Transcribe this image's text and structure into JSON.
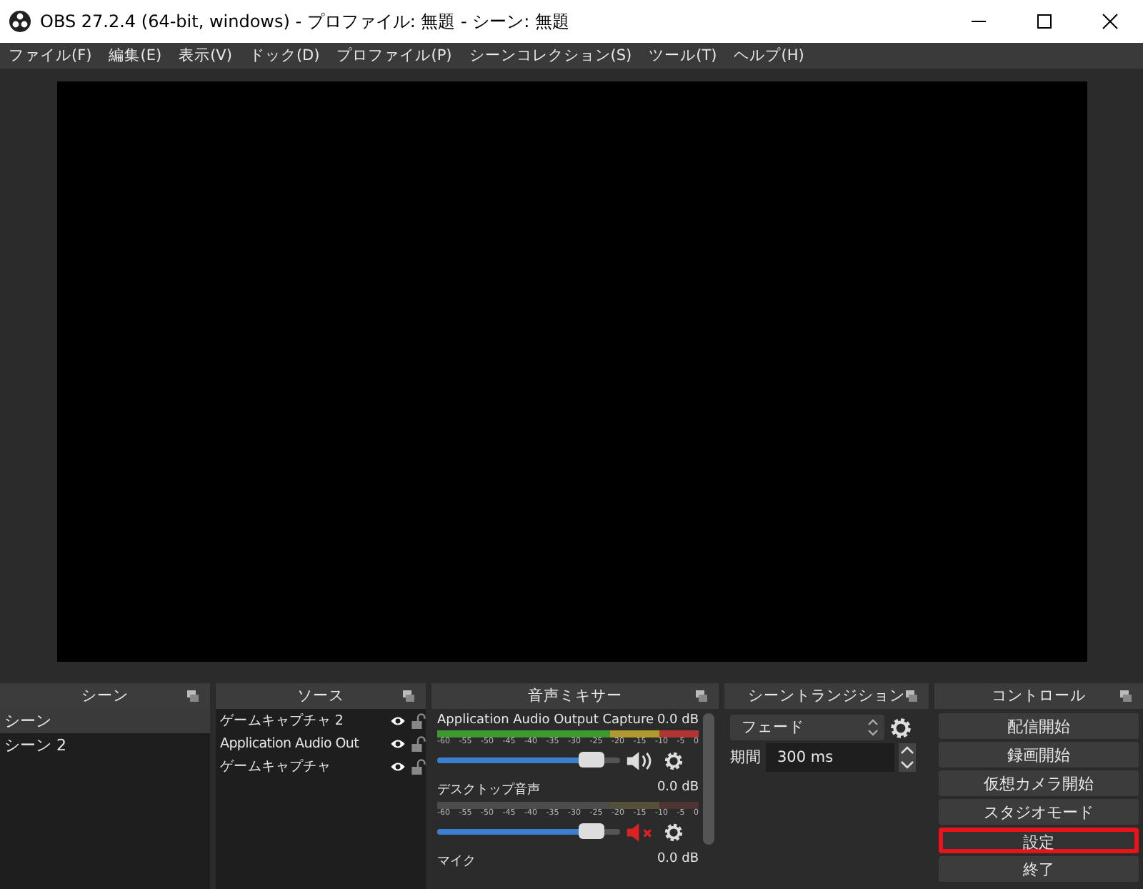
{
  "window": {
    "title": "OBS 27.2.4 (64-bit, windows) - プロファイル: 無題 - シーン: 無題"
  },
  "menu": [
    "ファイル(F)",
    "編集(E)",
    "表示(V)",
    "ドック(D)",
    "プロファイル(P)",
    "シーンコレクション(S)",
    "ツール(T)",
    "ヘルプ(H)"
  ],
  "scenes": {
    "title": "シーン",
    "items": [
      {
        "name": "シーン",
        "selected": true
      },
      {
        "name": "シーン 2",
        "selected": false
      }
    ]
  },
  "sources": {
    "title": "ソース",
    "items": [
      {
        "name": "ゲームキャプチャ 2",
        "visible": true,
        "locked": false
      },
      {
        "name": "Application Audio Out",
        "visible": true,
        "locked": false
      },
      {
        "name": "ゲームキャプチャ",
        "visible": true,
        "locked": false
      }
    ]
  },
  "mixer": {
    "title": "音声ミキサー",
    "channels": [
      {
        "name": "Application Audio Output Capture",
        "reading": "0.0 dB",
        "ticks": [
          "-60",
          "-55",
          "-50",
          "-45",
          "-40",
          "-35",
          "-30",
          "-25",
          "-20",
          "-15",
          "-10",
          "-5",
          "0"
        ],
        "level": 0.85,
        "muted": false
      },
      {
        "name": "デスクトップ音声",
        "reading": "0.0 dB",
        "ticks": [
          "-60",
          "-55",
          "-50",
          "-45",
          "-40",
          "-35",
          "-30",
          "-25",
          "-20",
          "-15",
          "-10",
          "-5",
          "0"
        ],
        "level": 0.85,
        "muted": true
      },
      {
        "name": "マイク",
        "reading": "0.0 dB"
      }
    ]
  },
  "transitions": {
    "title": "シーントランジション",
    "transition": "フェード",
    "duration_label": "期間",
    "duration": "300 ms"
  },
  "controls": {
    "title": "コントロール",
    "buttons": [
      {
        "label": "配信開始",
        "highlighted": false
      },
      {
        "label": "録画開始",
        "highlighted": false
      },
      {
        "label": "仮想カメラ開始",
        "highlighted": false
      },
      {
        "label": "スタジオモード",
        "highlighted": false
      },
      {
        "label": "設定",
        "highlighted": true
      },
      {
        "label": "終了",
        "highlighted": false
      }
    ]
  }
}
